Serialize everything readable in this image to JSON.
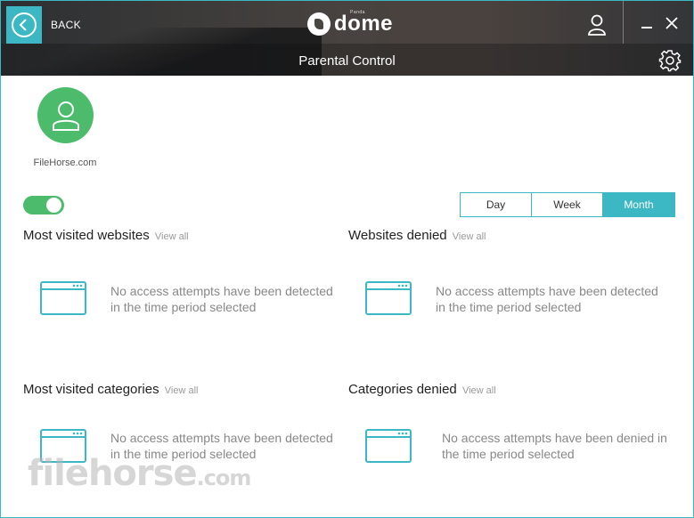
{
  "header": {
    "back_label": "BACK",
    "logo_text": "dome",
    "logo_small": "Panda",
    "title": "Parental Control"
  },
  "profile": {
    "name": "FileHorse.com",
    "enabled": true
  },
  "period": {
    "options": [
      "Day",
      "Week",
      "Month"
    ],
    "selected": "Month"
  },
  "panels": [
    {
      "title": "Most visited websites",
      "view_all": "View all",
      "message": "No access attempts have been detected in the time period selected"
    },
    {
      "title": "Websites denied",
      "view_all": "View all",
      "message": "No access attempts have been detected in the time period selected"
    },
    {
      "title": "Most visited categories",
      "view_all": "View all",
      "message": "No access attempts have been detected in the time period selected"
    },
    {
      "title": "Categories denied",
      "view_all": "View all",
      "message": "No access attempts have been denied in the time period selected"
    }
  ],
  "watermark": {
    "text": "filehorse",
    "suffix": ".com"
  },
  "colors": {
    "accent": "#3bb8c4",
    "green": "#4cbb6c"
  }
}
